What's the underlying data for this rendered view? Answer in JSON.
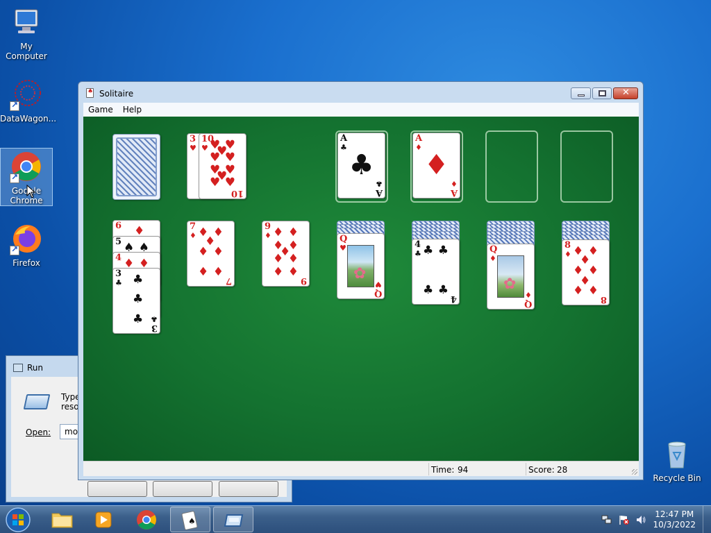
{
  "desktop": {
    "icons": [
      {
        "label": "My Computer"
      },
      {
        "label": "DataWagon..."
      },
      {
        "label": "Google Chrome"
      },
      {
        "label": "Firefox"
      },
      {
        "label": "Recycle Bin"
      }
    ]
  },
  "run_dialog": {
    "title": "Run",
    "description": "Type t\nresour",
    "open_label": "Open:",
    "open_value": "mou"
  },
  "solitaire": {
    "title": "Solitaire",
    "menu": [
      "Game",
      "Help"
    ],
    "status": {
      "time_label": "Time:",
      "time_value": "94",
      "score_label": "Score:",
      "score_value": "28"
    },
    "waste": [
      {
        "rank": "3",
        "suit": "♥"
      },
      {
        "rank": "10",
        "suit": "♥"
      }
    ],
    "foundations": [
      {
        "rank": "A",
        "suit": "♣"
      },
      {
        "rank": "A",
        "suit": "♦"
      }
    ],
    "tableau": [
      {
        "cards": [
          {
            "rank": "6",
            "suit": "♦"
          },
          {
            "rank": "5",
            "suit": "♠"
          },
          {
            "rank": "4",
            "suit": "♦"
          },
          {
            "rank": "3",
            "suit": "♣"
          }
        ]
      },
      {
        "cards": [
          {
            "rank": "7",
            "suit": "♦"
          }
        ]
      },
      {
        "cards": [
          {
            "rank": "9",
            "suit": "♦"
          }
        ]
      },
      {
        "cards": [
          {
            "rank": "Q",
            "suit": "♥"
          }
        ]
      },
      {
        "cards": [
          {
            "rank": "4",
            "suit": "♣"
          }
        ]
      },
      {
        "cards": [
          {
            "rank": "Q",
            "suit": "♦"
          }
        ]
      },
      {
        "cards": [
          {
            "rank": "8",
            "suit": "♦"
          }
        ]
      }
    ]
  },
  "taskbar": {
    "clock_time": "12:47 PM",
    "clock_date": "10/3/2022"
  },
  "colors": {
    "felt": "#147230",
    "red_suit": "#d42020",
    "black_suit": "#111111"
  }
}
